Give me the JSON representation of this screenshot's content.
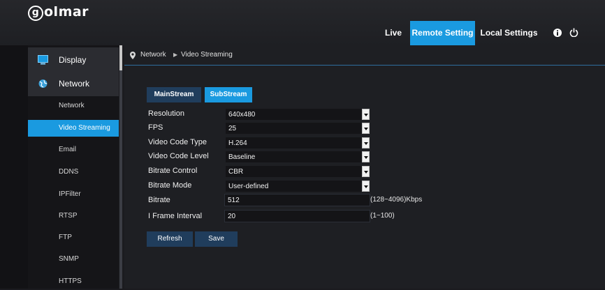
{
  "brand": {
    "logo_text": "olmar",
    "logo_letter": "g"
  },
  "topnav": {
    "live": "Live",
    "remote_setting": "Remote Setting",
    "local_settings": "Local Settings"
  },
  "colors": {
    "accent": "#1a9ae0",
    "dark_button": "#203d5c"
  },
  "icons": {
    "info": "info-icon",
    "power": "power-icon",
    "display": "monitor-icon",
    "network": "network-globe-icon",
    "location": "location-pin-icon"
  },
  "sidebar": {
    "sections": [
      {
        "label": "Display"
      },
      {
        "label": "Network"
      }
    ],
    "items": [
      {
        "label": "Network"
      },
      {
        "label": "Video Streaming",
        "active": true
      },
      {
        "label": "Email"
      },
      {
        "label": "DDNS"
      },
      {
        "label": "IPFilter"
      },
      {
        "label": "RTSP"
      },
      {
        "label": "FTP"
      },
      {
        "label": "SNMP"
      },
      {
        "label": "HTTPS"
      }
    ]
  },
  "breadcrumb": {
    "parent": "Network",
    "current": "Video Streaming"
  },
  "tabs": {
    "main": "MainStream",
    "sub": "SubStream",
    "active": "SubStream"
  },
  "form": {
    "resolution": {
      "label": "Resolution",
      "value": "640x480"
    },
    "fps": {
      "label": "FPS",
      "value": "25"
    },
    "video_code_type": {
      "label": "Video Code Type",
      "value": "H.264"
    },
    "video_code_level": {
      "label": "Video Code Level",
      "value": "Baseline"
    },
    "bitrate_control": {
      "label": "Bitrate Control",
      "value": "CBR"
    },
    "bitrate_mode": {
      "label": "Bitrate Mode",
      "value": "User-defined"
    },
    "bitrate": {
      "label": "Bitrate",
      "value": "512",
      "hint": "(128~4096)Kbps"
    },
    "iframe_interval": {
      "label": "I Frame Interval",
      "value": "20",
      "hint": "(1~100)"
    }
  },
  "buttons": {
    "refresh": "Refresh",
    "save": "Save"
  }
}
